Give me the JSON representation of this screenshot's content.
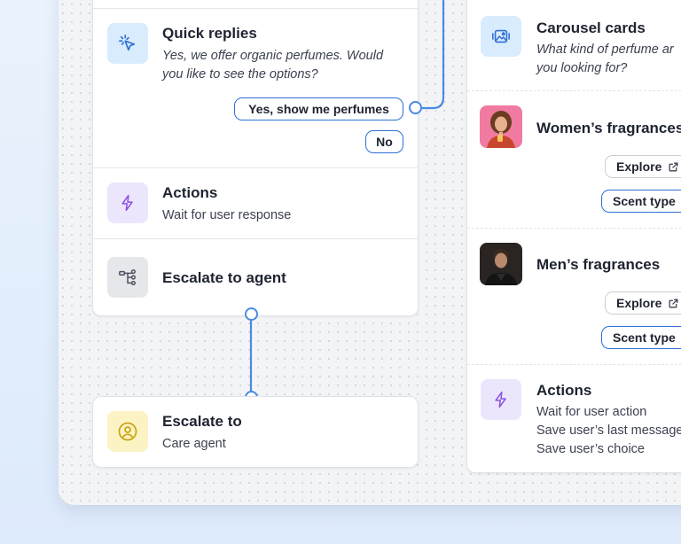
{
  "left_flow": {
    "quick_replies": {
      "icon": "cursor-click-icon",
      "title": "Quick replies",
      "text_line1": "Yes, we offer organic perfumes. Would",
      "text_line2": "you like to see the options?",
      "options": [
        "Yes, show me perfumes",
        "No"
      ]
    },
    "actions": {
      "icon": "lightning-icon",
      "title": "Actions",
      "text": "Wait for user response"
    },
    "escalate_agent": {
      "icon": "flow-branch-icon",
      "title": "Escalate to agent"
    }
  },
  "escalate_node": {
    "icon": "user-circle-icon",
    "title": "Escalate to",
    "text": "Care agent"
  },
  "right_flow": {
    "carousel": {
      "icon": "image-gallery-icon",
      "title": "Carousel cards",
      "text_line1": "What kind of perfume ar",
      "text_line2": "you looking for?"
    },
    "women": {
      "image": "woman-portrait-photo",
      "title": "Women’s fragrances",
      "explore": "Explore",
      "scent": "Scent type"
    },
    "men": {
      "image": "man-portrait-photo",
      "title": "Men’s fragrances",
      "explore": "Explore",
      "scent": "Scent type"
    },
    "actions": {
      "icon": "lightning-icon",
      "title": "Actions",
      "lines": [
        "Wait for user action",
        "Save user’s last message",
        "Save user’s choice"
      ]
    }
  },
  "colors": {
    "connector": "#4a8ae0",
    "chip_border": "#2f6fd6",
    "icon_blue_bg": "#d8ecfd",
    "icon_purple_bg": "#ece6fc",
    "icon_yellow_bg": "#fcf3c4"
  }
}
